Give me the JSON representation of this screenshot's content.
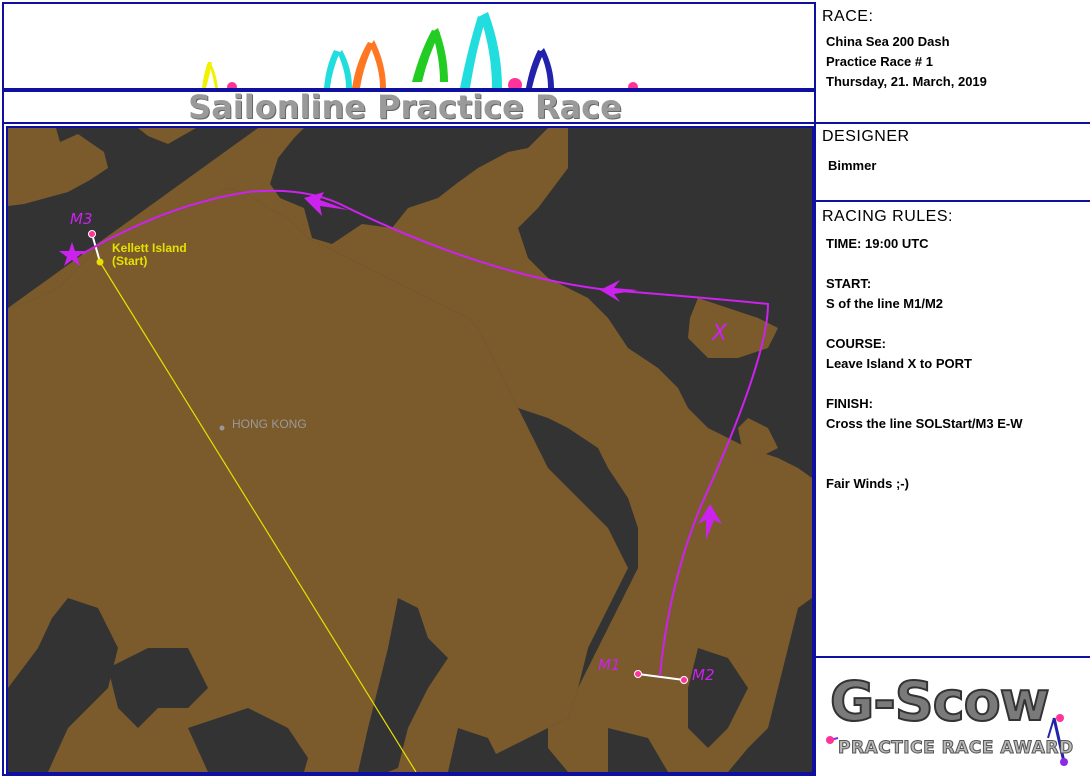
{
  "header": {
    "title": "Sailonline Practice Race"
  },
  "race": {
    "heading": "RACE:",
    "name": "China Sea 200 Dash",
    "subtitle": "Practice Race # 1",
    "date": "Thursday, 21. March, 2019"
  },
  "designer": {
    "heading": "DESIGNER",
    "name": "Bimmer"
  },
  "rules": {
    "heading": "RACING RULES:",
    "time": "TIME: 19:00 UTC",
    "start_label": "START:",
    "start_text": "S of the line M1/M2",
    "course_label": "COURSE:",
    "course_text": "Leave Island X to PORT",
    "finish_label": "FINISH:",
    "finish_text": "Cross the line SOLStart/M3 E-W",
    "closing": "Fair Winds ;-)"
  },
  "award": {
    "logo_text": "G-Scow",
    "subtitle": "PRACTICE RACE AWARD"
  },
  "map": {
    "city_label": "HONG KONG",
    "start_label_line1": "Kellett Island",
    "start_label_line2": "(Start)",
    "mark_m1": "M1",
    "mark_m2": "M2",
    "mark_m3": "M3",
    "island_x": "X",
    "colors": {
      "land": "#7b5b2c",
      "water": "#333333",
      "course": "#cc22ee",
      "mark": "#ff3399",
      "start_line": "#e8e000"
    }
  }
}
